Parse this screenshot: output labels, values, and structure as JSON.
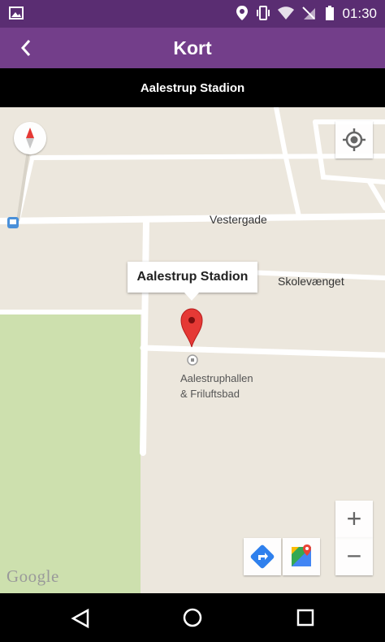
{
  "status_bar": {
    "time": "01:30",
    "icons": [
      "image-icon",
      "location-icon",
      "vibrate-icon",
      "wifi-icon",
      "no-sim-icon",
      "battery-icon"
    ]
  },
  "app_bar": {
    "title": "Kort",
    "back_icon": "chevron-left-icon"
  },
  "sub_header": {
    "title": "Aalestrup Stadion"
  },
  "map": {
    "info_window_title": "Aalestrup Stadion",
    "street_labels": [
      "Vestergade",
      "Skolevænget"
    ],
    "poi_label_line1": "Aalestruphallen",
    "poi_label_line2": "& Friluftsbad",
    "watermark": "Google",
    "controls": {
      "zoom_in": "+",
      "zoom_out": "−"
    },
    "colors": {
      "land": "#ece7dd",
      "park": "#cde0ae",
      "road": "#ffffff",
      "marker": "#e53935"
    }
  },
  "nav_bar": {
    "icons": [
      "back-triangle-icon",
      "home-circle-icon",
      "recents-square-icon"
    ]
  }
}
